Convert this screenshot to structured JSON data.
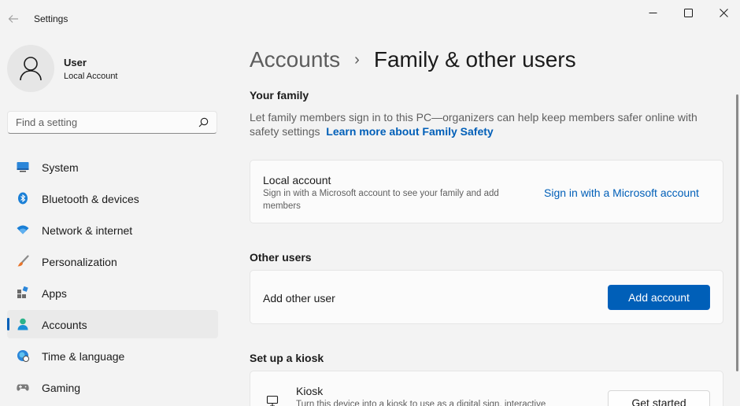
{
  "window": {
    "title": "Settings"
  },
  "profile": {
    "name": "User",
    "account_type": "Local Account"
  },
  "search": {
    "placeholder": "Find a setting"
  },
  "sidebar": {
    "items": [
      {
        "label": "System",
        "icon": "system-icon"
      },
      {
        "label": "Bluetooth & devices",
        "icon": "bluetooth-icon"
      },
      {
        "label": "Network & internet",
        "icon": "wifi-icon"
      },
      {
        "label": "Personalization",
        "icon": "brush-icon"
      },
      {
        "label": "Apps",
        "icon": "apps-icon"
      },
      {
        "label": "Accounts",
        "icon": "accounts-icon",
        "active": true
      },
      {
        "label": "Time & language",
        "icon": "globe-clock-icon"
      },
      {
        "label": "Gaming",
        "icon": "gamepad-icon"
      }
    ]
  },
  "breadcrumb": {
    "parent": "Accounts",
    "separator": "›",
    "current": "Family & other users"
  },
  "family": {
    "title": "Your family",
    "description": "Let family members sign in to this PC—organizers can help keep members safer online with safety settings",
    "link": "Learn more about Family Safety",
    "card": {
      "title": "Local account",
      "subtitle": "Sign in with a Microsoft account to see your family and add members",
      "action": "Sign in with a Microsoft account"
    }
  },
  "other_users": {
    "title": "Other users",
    "card": {
      "title": "Add other user",
      "button": "Add account"
    }
  },
  "kiosk": {
    "title": "Set up a kiosk",
    "card": {
      "title": "Kiosk",
      "subtitle": "Turn this device into a kiosk to use as a digital sign, interactive",
      "button": "Get started"
    }
  },
  "colors": {
    "accent": "#005fb8",
    "background": "#f3f3f3",
    "card": "#fbfbfb"
  }
}
